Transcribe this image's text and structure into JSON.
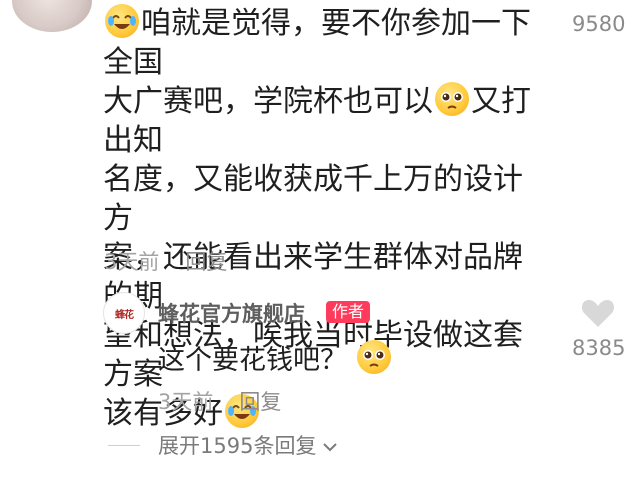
{
  "comment": {
    "line1": "咱就是觉得，要不你参加一下全国",
    "line2a": "大广赛吧，学院杯也可以",
    "line2b": "又打出知",
    "line3": "名度，又能收获成千上万的设计方",
    "line4": "案，还能看出来学生群体对品牌的期",
    "line5": "望和想法，唉我当时毕设做这套方案",
    "line6": "该有多好",
    "time": "3天前",
    "reply_label": "回复",
    "like_count": "9580"
  },
  "reply": {
    "author": "蜂花官方旗舰店",
    "badge": "作者",
    "logo_text": "蜂花",
    "text": "这个要花钱吧？",
    "time": "3天前",
    "reply_label": "回复",
    "like_count": "8385"
  },
  "expand": {
    "label": "展开1595条回复"
  },
  "icons": {
    "heart": "heart-icon",
    "chevron": "chevron-down-icon",
    "emoji_laugh_cry": "laugh-cry-emoji-icon",
    "emoji_pleading": "pleading-emoji-icon"
  },
  "colors": {
    "author_badge": "#ff3b5c",
    "heart": "#d8d8d8"
  }
}
